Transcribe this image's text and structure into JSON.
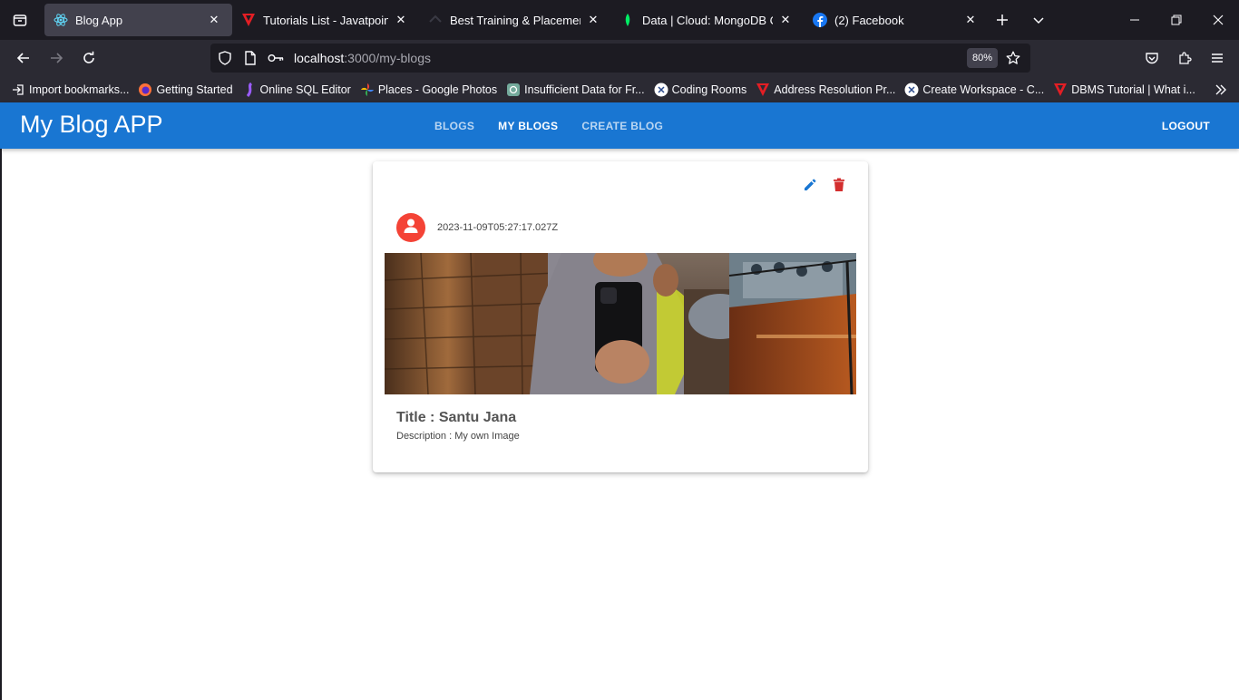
{
  "browser": {
    "tabs": [
      {
        "title": "Blog App",
        "active": true,
        "icon": "react-icon"
      },
      {
        "title": "Tutorials List - Javatpoint",
        "active": false,
        "icon": "javatpoint-icon"
      },
      {
        "title": "Best Training & Placement - J",
        "active": false,
        "icon": "training-icon"
      },
      {
        "title": "Data | Cloud: MongoDB Clou",
        "active": false,
        "icon": "mongodb-leaf-icon"
      },
      {
        "title": "(2) Facebook",
        "active": false,
        "icon": "facebook-icon"
      }
    ],
    "url": {
      "host": "localhost",
      "rest": ":3000/my-blogs"
    },
    "zoom": "80%",
    "bookmarks": [
      {
        "label": "Import bookmarks...",
        "icon": "import-icon"
      },
      {
        "label": "Getting Started",
        "icon": "firefox-icon"
      },
      {
        "label": "Online SQL Editor",
        "icon": "sql-editor-icon"
      },
      {
        "label": "Places - Google Photos",
        "icon": "google-photos-icon"
      },
      {
        "label": "Insufficient Data for Fr...",
        "icon": "openai-icon"
      },
      {
        "label": "Coding Rooms",
        "icon": "coding-rooms-icon"
      },
      {
        "label": "Address Resolution Pr...",
        "icon": "javatpoint-icon"
      },
      {
        "label": "Create Workspace - C...",
        "icon": "coding-rooms-icon"
      },
      {
        "label": "DBMS Tutorial | What i...",
        "icon": "javatpoint-icon"
      }
    ]
  },
  "app": {
    "title": "My Blog APP",
    "tabs": [
      {
        "label": "BLOGS",
        "selected": false
      },
      {
        "label": "MY BLOGS",
        "selected": true
      },
      {
        "label": "CREATE BLOG",
        "selected": false
      }
    ],
    "logout_label": "LOGOUT",
    "colors": {
      "appbar": "#1976d2",
      "avatar": "#f44336",
      "edit": "#1976d2",
      "delete": "#d32f2f"
    }
  },
  "blog": {
    "date": "2023-11-09T05:27:17.027Z",
    "title": "Title : Santu Jana",
    "description": "Description : My own Image"
  }
}
